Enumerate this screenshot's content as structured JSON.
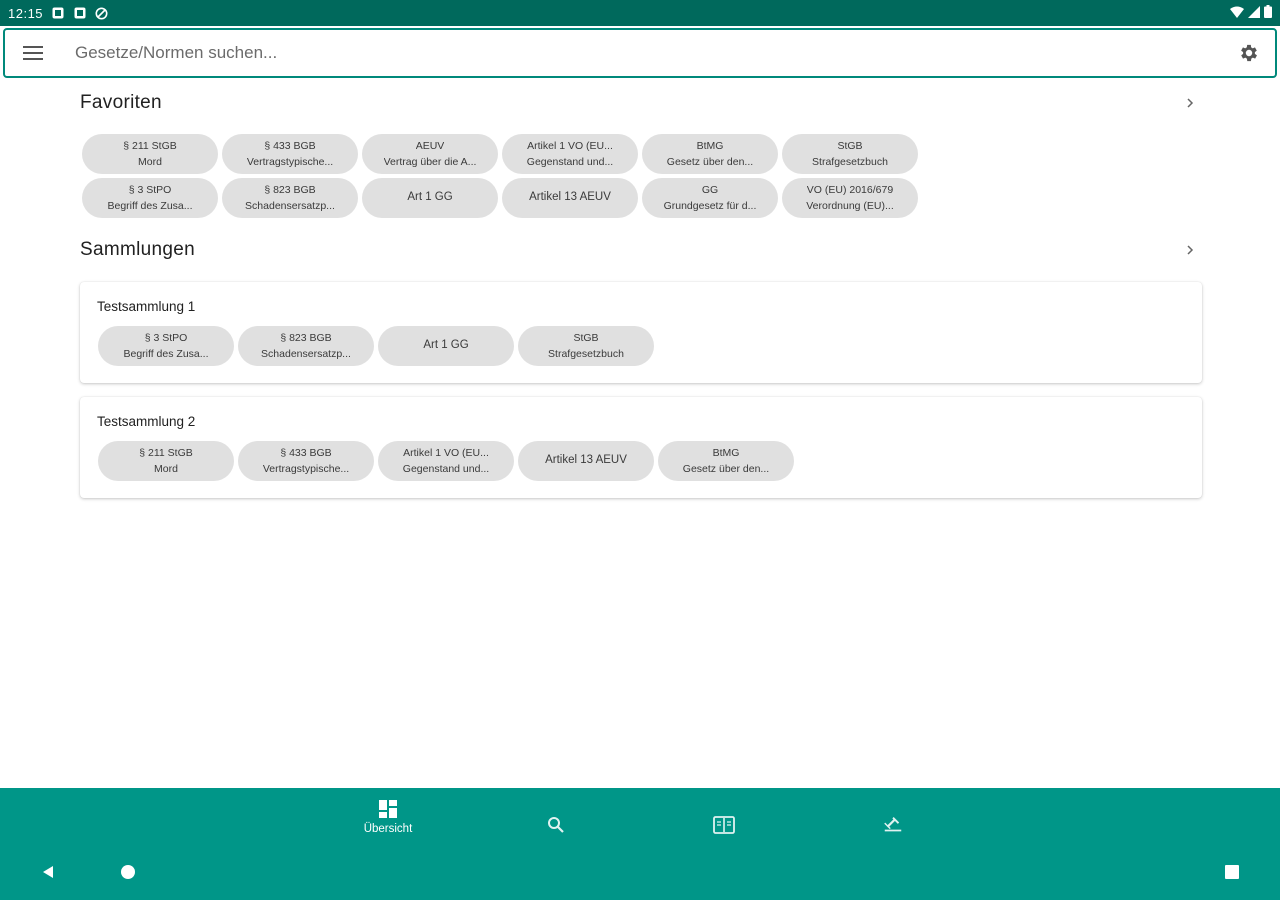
{
  "status_bar": {
    "time": "12:15"
  },
  "search": {
    "placeholder": "Gesetze/Normen suchen..."
  },
  "favorites": {
    "title": "Favoriten",
    "chips": [
      {
        "line1": "§ 211 StGB",
        "line2": "Mord"
      },
      {
        "line1": "§ 433 BGB",
        "line2": "Vertragstypische..."
      },
      {
        "line1": "AEUV",
        "line2": "Vertrag über die A..."
      },
      {
        "line1": "Artikel 1 VO (EU...",
        "line2": "Gegenstand und..."
      },
      {
        "line1": "BtMG",
        "line2": "Gesetz über den..."
      },
      {
        "line1": "StGB",
        "line2": "Strafgesetzbuch"
      },
      {
        "line1": "§ 3 StPO",
        "line2": "Begriff des Zusa..."
      },
      {
        "line1": "§ 823 BGB",
        "line2": "Schadensersatzp..."
      },
      {
        "line1": "Art 1 GG",
        "line2": ""
      },
      {
        "line1": "Artikel 13 AEUV",
        "line2": ""
      },
      {
        "line1": "GG",
        "line2": "Grundgesetz für d..."
      },
      {
        "line1": "VO (EU) 2016/679",
        "line2": "Verordnung (EU)..."
      }
    ]
  },
  "collections": {
    "title": "Sammlungen",
    "items": [
      {
        "name": "Testsammlung 1",
        "chips": [
          {
            "line1": "§ 3 StPO",
            "line2": "Begriff des Zusa..."
          },
          {
            "line1": "§ 823 BGB",
            "line2": "Schadensersatzp..."
          },
          {
            "line1": "Art 1 GG",
            "line2": ""
          },
          {
            "line1": "StGB",
            "line2": "Strafgesetzbuch"
          }
        ]
      },
      {
        "name": "Testsammlung 2",
        "chips": [
          {
            "line1": "§ 211 StGB",
            "line2": "Mord"
          },
          {
            "line1": "§ 433 BGB",
            "line2": "Vertragstypische..."
          },
          {
            "line1": "Artikel 1 VO (EU...",
            "line2": "Gegenstand und..."
          },
          {
            "line1": "Artikel 13 AEUV",
            "line2": ""
          },
          {
            "line1": "BtMG",
            "line2": "Gesetz über den..."
          }
        ]
      }
    ]
  },
  "bottom_nav": {
    "items": [
      {
        "label": "Übersicht",
        "icon": "dashboard-icon",
        "active": true
      },
      {
        "label": "",
        "icon": "search-icon",
        "active": false
      },
      {
        "label": "",
        "icon": "book-icon",
        "active": false
      },
      {
        "label": "",
        "icon": "law-icon",
        "active": false
      }
    ]
  },
  "colors": {
    "status_bar": "#00695c",
    "accent": "#009688",
    "chip": "#e0e0e0"
  }
}
